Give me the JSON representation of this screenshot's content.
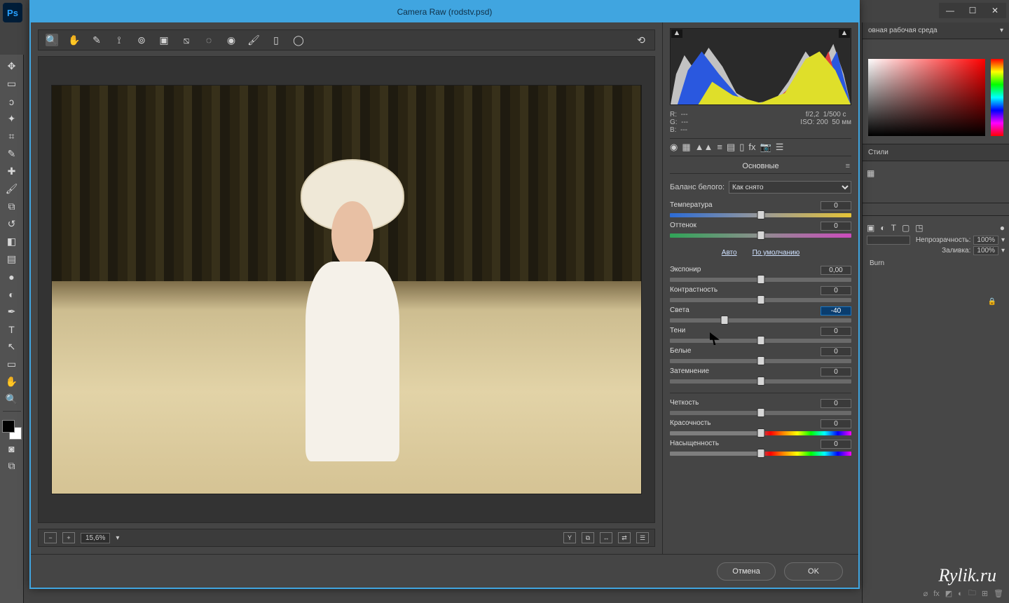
{
  "os": {
    "minimize": "—",
    "maximize": "☐",
    "close": "✕"
  },
  "ps": {
    "workspace_label": "овная рабочая среда",
    "panel_styles": "Стили",
    "opacity_label": "Непрозрачность:",
    "opacity_value": "100%",
    "fill_label": "Заливка:",
    "fill_value": "100%",
    "layer_name": "Burn",
    "watermark": "Rylik.ru"
  },
  "cr": {
    "title": "Camera Raw (rodstv.psd)",
    "zoom": "15,6%",
    "rgb": {
      "r": "R:",
      "g": "G:",
      "b": "B:",
      "dash": "---"
    },
    "shot": {
      "aperture": "f/2,2",
      "shutter": "1/500 c",
      "iso_label": "ISO:",
      "iso": "200",
      "focal": "50 мм"
    },
    "panel_title": "Основные",
    "wb_label": "Баланс белого:",
    "wb_value": "Как снято",
    "auto": "Авто",
    "default": "По умолчанию",
    "btn_cancel": "Отмена",
    "btn_ok": "OK",
    "sliders": {
      "temperature": {
        "label": "Температура",
        "value": "0",
        "pos": 50
      },
      "tint": {
        "label": "Оттенок",
        "value": "0",
        "pos": 50
      },
      "exposure": {
        "label": "Экспонир",
        "value": "0,00",
        "pos": 50
      },
      "contrast": {
        "label": "Контрастность",
        "value": "0",
        "pos": 50
      },
      "highlights": {
        "label": "Света",
        "value": "-40",
        "pos": 30,
        "active": true
      },
      "shadows": {
        "label": "Тени",
        "value": "0",
        "pos": 50
      },
      "whites": {
        "label": "Белые",
        "value": "0",
        "pos": 50
      },
      "blacks": {
        "label": "Затемнение",
        "value": "0",
        "pos": 50
      },
      "clarity": {
        "label": "Четкость",
        "value": "0",
        "pos": 50
      },
      "vibrance": {
        "label": "Красочность",
        "value": "0",
        "pos": 50
      },
      "saturation": {
        "label": "Насыщенность",
        "value": "0",
        "pos": 50
      }
    },
    "bottombar": {
      "y_icon": "Y"
    }
  }
}
